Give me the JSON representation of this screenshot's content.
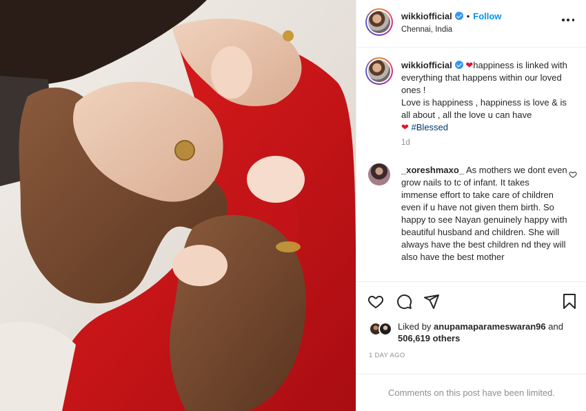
{
  "post": {
    "username": "wikkiofficial",
    "separator": "•",
    "follow_label": "Follow",
    "location": "Chennai, India"
  },
  "caption": {
    "username": "wikkiofficial",
    "line1": "happiness is linked with everything that happens within our loved ones !",
    "line2": "Love is happiness , happiness is love & is all about , all the love u can have",
    "hashtag": "#Blessed",
    "time": "1d"
  },
  "comment": {
    "username": "_xoreshmaxo_",
    "text": "As mothers we dont even grow nails to tc of infant. It takes immense effort to take care of children even if u have not given them birth. So happy to see Nayan genuinely happy with beautiful husband and children. She will always have the best children nd they will also have the best mother"
  },
  "likes": {
    "prefix": "Liked by",
    "by_user": "anupamaparameswaran96",
    "and": "and",
    "others": "506,619 others"
  },
  "timestamp": "1 DAY AGO",
  "comments_limited": "Comments on this post have been limited.",
  "icons": {
    "more": "more-options-icon",
    "verified": "verified-badge-icon",
    "like": "heart-icon",
    "comment": "comment-icon",
    "share": "paper-plane-icon",
    "save": "bookmark-icon"
  },
  "colors": {
    "accent": "#0095f6",
    "heart": "#e0142b",
    "muted": "#8e8e8e",
    "text": "#262626"
  }
}
